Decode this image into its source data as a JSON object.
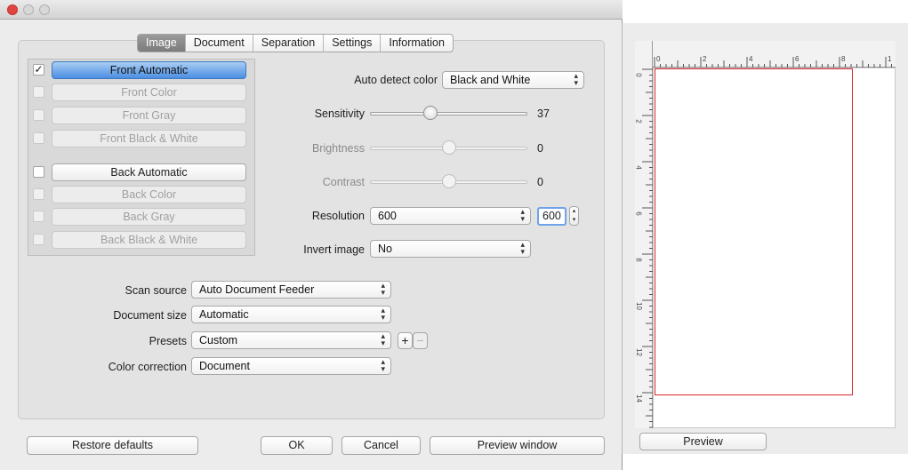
{
  "tabs": [
    "Image",
    "Document",
    "Separation",
    "Settings",
    "Information"
  ],
  "image_types": [
    {
      "label": "Front Automatic",
      "checked": true,
      "state": "selected"
    },
    {
      "label": "Front Color",
      "checked": false,
      "state": "disabled"
    },
    {
      "label": "Front Gray",
      "checked": false,
      "state": "disabled"
    },
    {
      "label": "Front Black & White",
      "checked": false,
      "state": "disabled"
    },
    {
      "label": "Back Automatic",
      "checked": false,
      "state": "enabled"
    },
    {
      "label": "Back Color",
      "checked": false,
      "state": "disabled"
    },
    {
      "label": "Back Gray",
      "checked": false,
      "state": "disabled"
    },
    {
      "label": "Back Black & White",
      "checked": false,
      "state": "disabled"
    }
  ],
  "auto_detect": {
    "label": "Auto detect color",
    "value": "Black and White"
  },
  "sliders": [
    {
      "label": "Sensitivity",
      "value": "37",
      "level": 0.37,
      "enabled": true
    },
    {
      "label": "Brightness",
      "value": "0",
      "level": 0.5,
      "enabled": false
    },
    {
      "label": "Contrast",
      "value": "0",
      "level": 0.5,
      "enabled": false
    }
  ],
  "resolution": {
    "label": "Resolution",
    "value": "600",
    "field": "600"
  },
  "invert": {
    "label": "Invert image",
    "value": "No"
  },
  "scan": {
    "scan_source": {
      "label": "Scan source",
      "value": "Auto Document Feeder"
    },
    "document_size": {
      "label": "Document size",
      "value": "Automatic"
    },
    "presets": {
      "label": "Presets",
      "value": "Custom",
      "add": "+",
      "remove": "−"
    },
    "color_correction": {
      "label": "Color correction",
      "value": "Document"
    }
  },
  "buttons": {
    "restore": "Restore defaults",
    "ok": "OK",
    "cancel": "Cancel",
    "preview_window": "Preview window"
  },
  "preview": {
    "button": "Preview",
    "ruler_top": [
      "0",
      "2",
      "4",
      "6",
      "8",
      "1"
    ],
    "ruler_left": [
      "0",
      "2",
      "4",
      "6",
      "8",
      "10",
      "12",
      "14"
    ]
  },
  "colors": {
    "selection_blue": "#4b8ee2",
    "scan_area_red": "#d8282e",
    "close_red": "#e0463f"
  }
}
